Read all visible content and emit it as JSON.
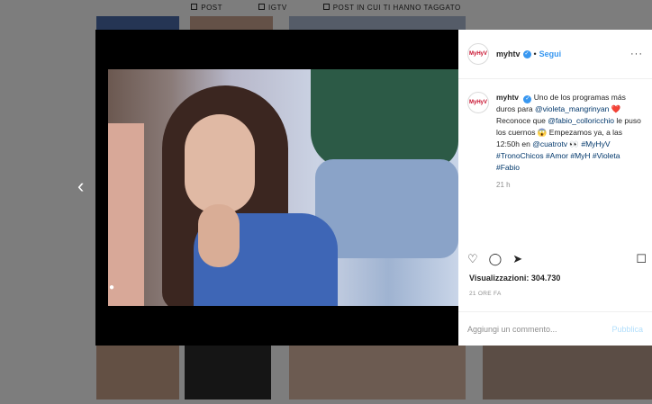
{
  "profile_tabs": [
    "POST",
    "IGTV",
    "POST IN CUI TI HANNO TAGGATO"
  ],
  "post": {
    "username": "myhtv",
    "avatar_text": "MyHyV",
    "follow_label": "Segui",
    "more_label": "···",
    "caption": {
      "p1": "Uno de los programas más duros para ",
      "mention1": "@violeta_mangrinyan",
      "p2": " ❤️ Reconoce que ",
      "mention2": "@fabio_colloricchio",
      "p3": " le puso los cuernos 😱 Empezamos ya, a las 12:50h en ",
      "mention3": "@cuatrotv",
      "p4": " 👀 ",
      "hashtags": "#MyHyV #TronoChicos #Amor #MyH #Violeta #Fabio"
    },
    "time_ago": "21 h",
    "views_label": "Visualizzazioni:",
    "views_count": "304.730",
    "posted_ago": "21 ORE FA",
    "comment_placeholder": "Aggiungi un commento...",
    "publish_label": "Pubblica"
  },
  "icons": {
    "like": "heart-icon",
    "comment": "comment-icon",
    "share": "share-icon",
    "save": "bookmark-icon",
    "prev": "chevron-left-icon",
    "tagged_user": "person-icon"
  },
  "colors": {
    "accent": "#3897f0",
    "verified": "#3897f0",
    "brand": "#c8102e"
  }
}
